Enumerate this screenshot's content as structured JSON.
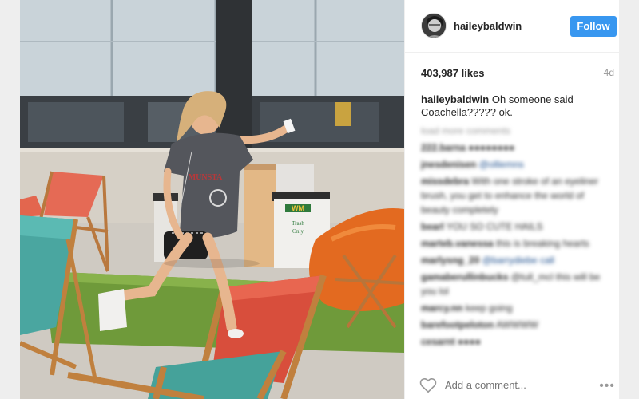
{
  "post": {
    "username": "haileybaldwin",
    "follow_label": "Follow",
    "likes": "403,987 likes",
    "time_ago": "4d",
    "caption_user": "haileybaldwin",
    "caption_text": " Oh someone said Coachella????? ok.",
    "comments": [
      {
        "user": "load more comments",
        "text": ""
      },
      {
        "user": "222.barna",
        "text": "●●●●●●●●"
      },
      {
        "user": "jnesdenisen",
        "text": "@olliemns"
      },
      {
        "user": "missdebra",
        "text": "With one stroke of an eyeliner brush, you get to enhance the world of beauty completely"
      },
      {
        "user": "bearl",
        "text": "YOU SO CUTE HAILS"
      },
      {
        "user": "marteb.vanessa",
        "text": "this is breaking hearts"
      },
      {
        "user": "marlysng_20",
        "text": "@barrydiebe call"
      },
      {
        "user": "gamaberullinbucks",
        "text": "@tull_mcl this will be you lol"
      },
      {
        "user": "marcy.nn",
        "text": "keep going"
      },
      {
        "user": "barefootpeloton",
        "text": "AWWWW"
      },
      {
        "user": "cesarnt",
        "text": "●●●●"
      }
    ],
    "add_comment_placeholder": "Add a comment...",
    "more_icon": "•••"
  },
  "photo": {
    "sign_text_1": "Trash",
    "sign_text_2": "Only",
    "logo_text": "WM"
  },
  "colors": {
    "follow_bg": "#3897f0",
    "text": "#262626",
    "muted": "#999999"
  }
}
